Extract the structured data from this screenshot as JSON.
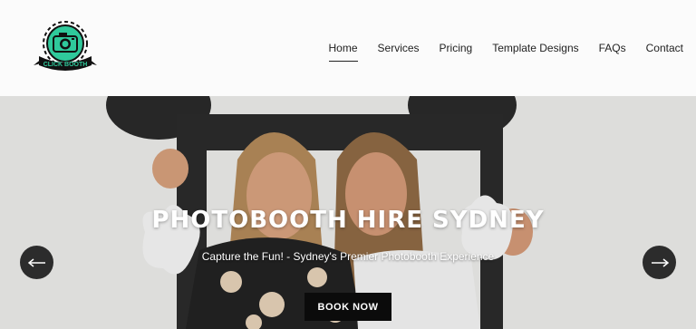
{
  "brand": {
    "logo_text": "CLICK BOOTH",
    "colors": {
      "logo_green": "#2fc99b",
      "logo_dark": "#111111"
    }
  },
  "nav": {
    "items": [
      {
        "label": "Home",
        "active": true
      },
      {
        "label": "Services"
      },
      {
        "label": "Pricing"
      },
      {
        "label": "Template Designs"
      },
      {
        "label": "FAQs"
      },
      {
        "label": "Contact"
      }
    ]
  },
  "hero": {
    "title": "PHOTOBOOTH HIRE SYDNEY",
    "subtitle": "Capture the Fun! - Sydney's Premier Photobooth Experience",
    "cta_label": "BOOK NOW",
    "prev_icon": "arrow-left-icon",
    "next_icon": "arrow-right-icon"
  }
}
